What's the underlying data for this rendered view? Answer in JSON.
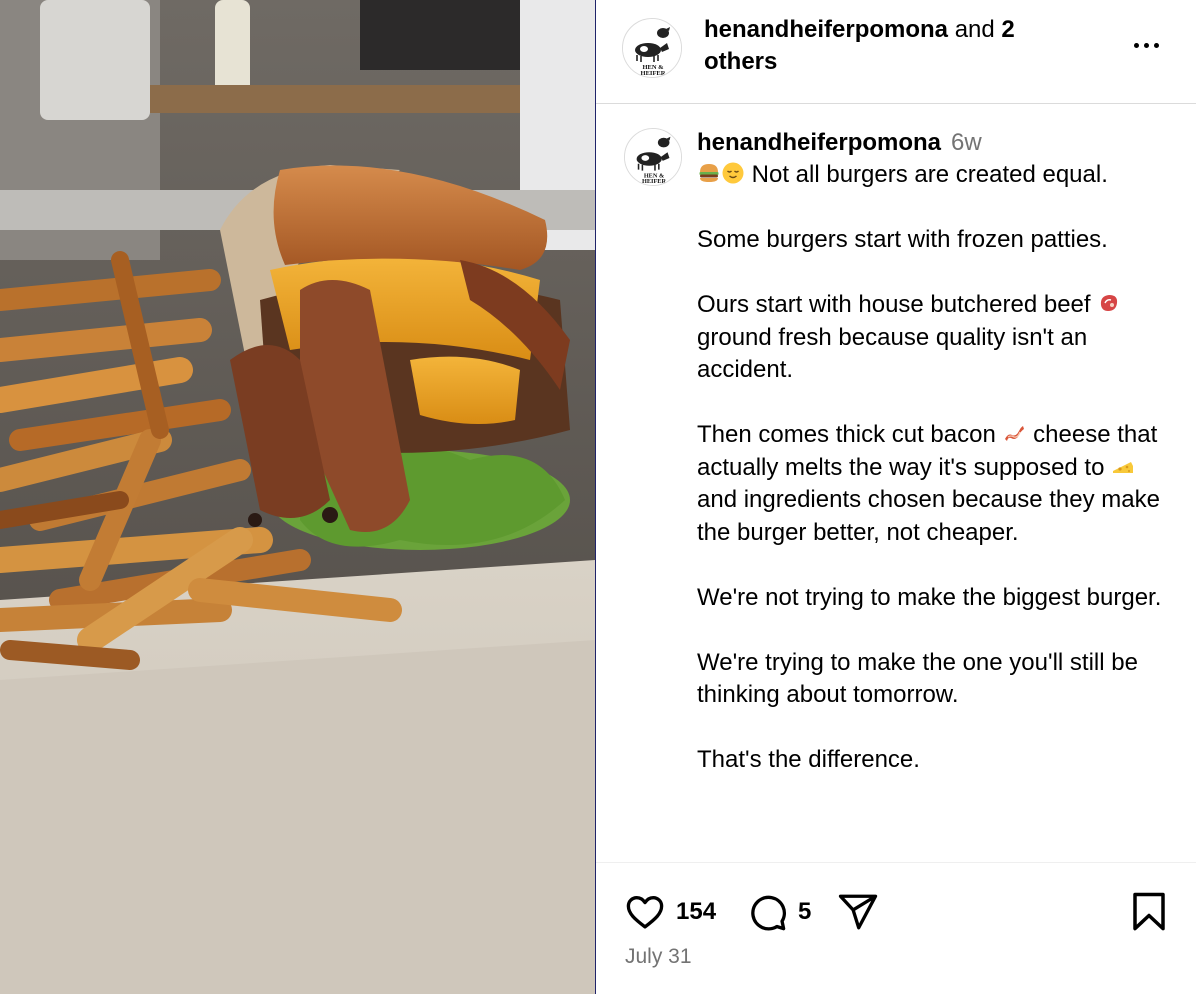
{
  "post": {
    "media_alt": "Burger with bacon, cheese and lettuce beside fries",
    "header": {
      "username": "henandheiferpomona",
      "collaborators_joiner": " and ",
      "collaborators_count_text": "2 others",
      "logo_text_top": "HEN &",
      "logo_text_bottom": "HEIFER",
      "more_icon": "more-horizontal-icon"
    },
    "caption": {
      "username": "henandheiferpomona",
      "time_ago": "6w",
      "line1_emojis": [
        "burger-emoji",
        "relieved-face-emoji"
      ],
      "line1_text": " Not all burgers are created equal.",
      "p2": "Some burgers start with frozen patties.",
      "p3_before": "Ours start with house butchered beef ",
      "p3_emoji": "cut-of-meat-emoji",
      "p3_after": " ground fresh because quality isn't an accident.",
      "p4_a": "Then comes thick cut bacon ",
      "p4_emoji1": "bacon-emoji",
      "p4_b": " cheese that actually melts the way it's supposed to ",
      "p4_emoji2": "cheese-emoji",
      "p4_c": " and ingredients chosen because they make the burger better, not cheaper.",
      "p5": "We're not trying to make the biggest burger.",
      "p6": "We're trying to make the one you'll still be thinking about tomorrow.",
      "p7": "That's the difference."
    },
    "actions": {
      "like_icon": "heart-icon",
      "likes": "154",
      "comment_icon": "comment-icon",
      "comments": "5",
      "share_icon": "send-icon",
      "save_icon": "bookmark-icon"
    },
    "date": "July 31"
  },
  "colors": {
    "secondary_text": "#737373",
    "border": "#dbdbdb",
    "text": "#000000"
  }
}
